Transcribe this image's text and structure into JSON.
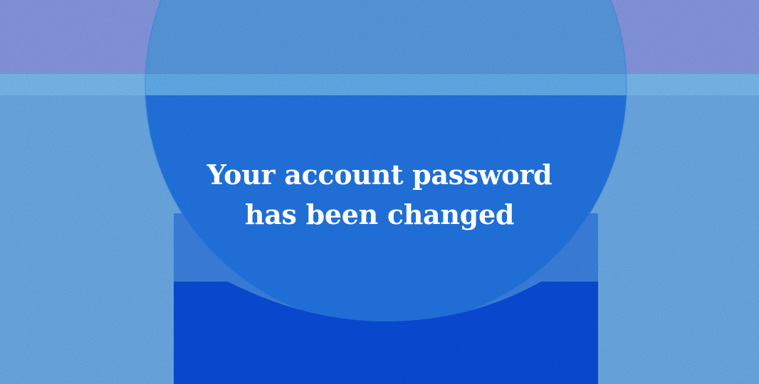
{
  "headline": {
    "line1": "Your account password",
    "line2": "has been changed"
  },
  "colors": {
    "top_band": "#8a9de8",
    "background": "#6fb0ee",
    "circle_upper": "#4f8fe6",
    "circle_lower": "#1f6fe6",
    "circle_band": "#64b4f4",
    "pillar": "#0a4fe0",
    "text": "#ffffff"
  }
}
